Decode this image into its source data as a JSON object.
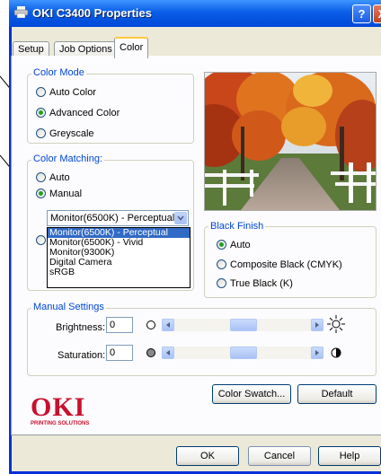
{
  "window": {
    "title": "OKI C3400 Properties",
    "help_btn": "?",
    "close_btn": "X"
  },
  "tabs": [
    {
      "label": "Setup"
    },
    {
      "label": "Job Options"
    },
    {
      "label": "Color"
    }
  ],
  "color_mode": {
    "label": "Color Mode",
    "options": [
      {
        "label": "Auto Color",
        "selected": false
      },
      {
        "label": "Advanced Color",
        "selected": true
      },
      {
        "label": "Greyscale",
        "selected": false
      }
    ]
  },
  "color_matching": {
    "label": "Color Matching:",
    "options": [
      {
        "label": "Auto",
        "selected": false
      },
      {
        "label": "Manual",
        "selected": true
      }
    ],
    "combo_value": "Monitor(6500K) - Perceptual",
    "list": [
      "Monitor(6500K) - Perceptual",
      "Monitor(6500K) - Vivid",
      "Monitor(9300K)",
      "Digital Camera",
      "sRGB"
    ],
    "selected_index": 0
  },
  "black_finish": {
    "label": "Black Finish",
    "options": [
      {
        "label": "Auto",
        "selected": true
      },
      {
        "label": "Composite Black (CMYK)",
        "selected": false
      },
      {
        "label": "True Black (K)",
        "selected": false
      }
    ]
  },
  "manual_settings": {
    "label": "Manual Settings",
    "brightness": {
      "label": "Brightness:",
      "value": "0"
    },
    "saturation": {
      "label": "Saturation:",
      "value": "0"
    }
  },
  "buttons": {
    "color_swatch": "Color Swatch...",
    "default": "Default",
    "ok": "OK",
    "cancel": "Cancel",
    "help": "Help"
  },
  "logo": {
    "brand": "OKI",
    "tagline": "PRINTING SOLUTIONS",
    "color": "#c8102e"
  },
  "accent": {
    "title_blue": "#0a5ee6",
    "group_label": "#0046d5",
    "selection": "#316ac5",
    "tab_highlight": "#ffc83c"
  }
}
